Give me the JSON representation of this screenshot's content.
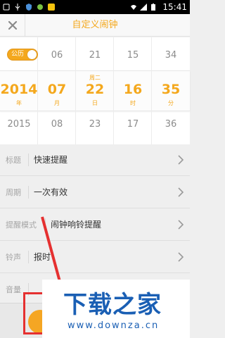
{
  "status_bar": {
    "time": "15:41"
  },
  "title_bar": {
    "close_icon": "close-icon",
    "title": "自定义闹钟"
  },
  "picker": {
    "calendar_toggle_label": "公历",
    "columns": [
      {
        "key": "year",
        "above": "",
        "value": "2014",
        "unit": "年",
        "below": "2015",
        "weekday": ""
      },
      {
        "key": "month",
        "above": "06",
        "value": "07",
        "unit": "月",
        "below": "08",
        "weekday": ""
      },
      {
        "key": "day",
        "above": "21",
        "value": "22",
        "unit": "日",
        "below": "23",
        "weekday": "周二"
      },
      {
        "key": "hour",
        "above": "15",
        "value": "16",
        "unit": "时",
        "below": "17",
        "weekday": ""
      },
      {
        "key": "minute",
        "above": "34",
        "value": "35",
        "unit": "分",
        "below": "36",
        "weekday": ""
      }
    ]
  },
  "settings": [
    {
      "label": "标题",
      "value": "快速提醒"
    },
    {
      "label": "周期",
      "value": "一次有效"
    },
    {
      "label": "提醒模式",
      "value": "闹钟响铃提醒"
    },
    {
      "label": "铃声",
      "value": "报时"
    },
    {
      "label": "音量",
      "value": ""
    }
  ],
  "watermark": {
    "logo": "下载之家",
    "url": "www.downza.cn"
  },
  "colors": {
    "accent": "#f4a81d",
    "annotation": "#e53030"
  }
}
